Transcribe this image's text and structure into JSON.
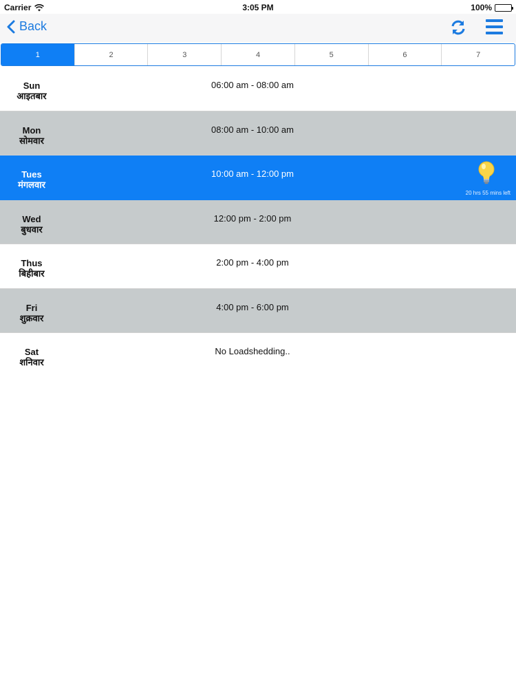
{
  "status_bar": {
    "carrier": "Carrier",
    "time": "3:05 PM",
    "battery": "100%"
  },
  "nav": {
    "back_label": "Back"
  },
  "tabs": [
    "1",
    "2",
    "3",
    "4",
    "5",
    "6",
    "7"
  ],
  "schedule": [
    {
      "day": "Sun",
      "day_local": "आइतबार",
      "time": "06:00 am - 08:00 am"
    },
    {
      "day": "Mon",
      "day_local": "सोमवार",
      "time": "08:00 am - 10:00 am"
    },
    {
      "day": "Tues",
      "day_local": "मंगलवार",
      "time": "10:00 am - 12:00 pm",
      "remaining": "20 hrs 55 mins left"
    },
    {
      "day": "Wed",
      "day_local": "बुधवार",
      "time": "12:00 pm - 2:00 pm"
    },
    {
      "day": "Thus",
      "day_local": "बिहीबार",
      "time": "2:00 pm - 4:00 pm"
    },
    {
      "day": "Fri",
      "day_local": "शुक्रवार",
      "time": "4:00 pm - 6:00 pm"
    },
    {
      "day": "Sat",
      "day_local": "शनिवार",
      "time": "No Loadshedding.."
    }
  ],
  "colors": {
    "accent": "#1c7be0",
    "active_row": "#0f7ff5",
    "alt_row": "#c6cbcc",
    "bulb": "#f9d548"
  },
  "icons": {
    "back": "chevron-left-icon",
    "refresh": "refresh-icon",
    "menu": "hamburger-menu-icon",
    "bulb": "lightbulb-icon",
    "wifi": "wifi-icon",
    "battery": "battery-icon"
  }
}
